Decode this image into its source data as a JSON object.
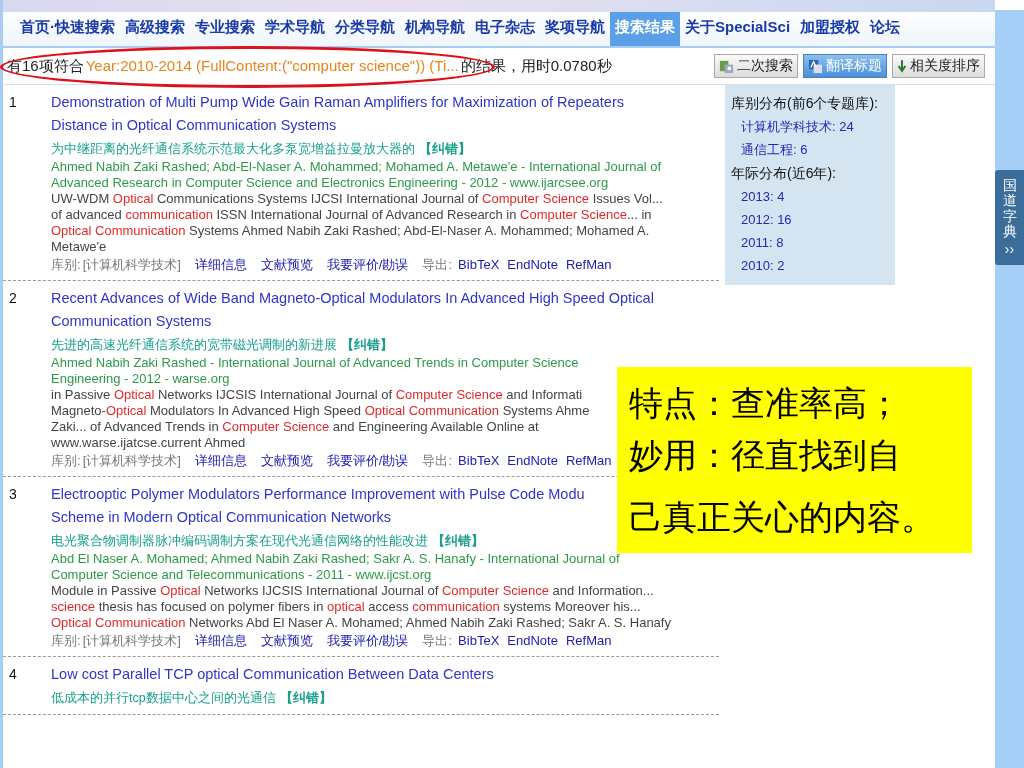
{
  "nav": [
    {
      "label": "首页·快速搜索",
      "selected": false
    },
    {
      "label": "高级搜索",
      "selected": false
    },
    {
      "label": "专业搜索",
      "selected": false
    },
    {
      "label": "学术导航",
      "selected": false
    },
    {
      "label": "分类导航",
      "selected": false
    },
    {
      "label": "机构导航",
      "selected": false
    },
    {
      "label": "电子杂志",
      "selected": false
    },
    {
      "label": "奖项导航",
      "selected": false
    },
    {
      "label": "搜索结果",
      "selected": true
    },
    {
      "label": "关于SpecialSci",
      "selected": false
    },
    {
      "label": "加盟授权",
      "selected": false
    },
    {
      "label": "论坛",
      "selected": false
    }
  ],
  "summary": {
    "prefix": "有16项符合",
    "query": "Year:2010-2014 (FullContent:(\"computer science\")) (Ti...",
    "suffix": "的结果，用时0.0780秒"
  },
  "toolbar": [
    {
      "label": "二次搜索",
      "kind": "refine",
      "selected": false
    },
    {
      "label": "翻译标题",
      "kind": "translate",
      "selected": true
    },
    {
      "label": "相关度排序",
      "kind": "sort",
      "selected": false
    }
  ],
  "results": [
    {
      "number": "1",
      "title_lines": [
        "Demonstration of Multi Pump Wide Gain Raman Amplifiers for Maximization of Repeaters",
        "Distance in Optical Communication Systems"
      ],
      "translation": "为中继距离的光纤通信系统示范最大化多泵宽增益拉曼放大器的",
      "fix": "【纠错】",
      "source_lines": [
        "Ahmed Nabih Zaki Rashed; Abd-El-Naser A. Mohammed; Mohamed A. Metawe'e - International Journal of",
        "Advanced Research in Computer Science and Electronics Engineering - 2012 - www.ijarcsee.org"
      ],
      "snippet_lines": [
        [
          {
            "text": "UW-WDM ",
            "hit": false
          },
          {
            "text": "Optical",
            "hit": true
          },
          {
            "text": " Communications Systems IJCSI International Journal of ",
            "hit": false
          },
          {
            "text": "Computer Science",
            "hit": true
          },
          {
            "text": " Issues Vol...",
            "hit": false
          }
        ],
        [
          {
            "text": "of advanced ",
            "hit": false
          },
          {
            "text": "communication",
            "hit": true
          },
          {
            "text": " ISSN International Journal of Advanced Research in ",
            "hit": false
          },
          {
            "text": "Computer Science",
            "hit": true
          },
          {
            "text": "... in",
            "hit": false
          }
        ],
        [
          {
            "text": "Optical Communication",
            "hit": true
          },
          {
            "text": " Systems Ahmed Nabih Zaki Rashed; Abd-El-Naser A. Mohammed; Mohamed A.",
            "hit": false
          }
        ],
        [
          {
            "text": "Metawe'e",
            "hit": false
          }
        ]
      ],
      "footer": {
        "library_label": "库别:",
        "library": "[计算机科学技术]",
        "links": [
          "详细信息",
          "文献预览",
          "我要评价/勘误"
        ],
        "export_label": "导出:",
        "exports": [
          "BibTeX",
          "EndNote",
          "RefMan"
        ]
      }
    },
    {
      "number": "2",
      "title_lines": [
        "Recent Advances of Wide Band Magneto-Optical Modulators In Advanced High Speed Optical",
        "Communication Systems"
      ],
      "translation": "先进的高速光纤通信系统的宽带磁光调制的新进展",
      "fix": "【纠错】",
      "source_lines": [
        "Ahmed Nabih Zaki Rashed - International Journal of Advanced Trends in Computer Science",
        "Engineering - 2012 - warse.org"
      ],
      "snippet_lines": [
        [
          {
            "text": "in Passive ",
            "hit": false
          },
          {
            "text": "Optical",
            "hit": true
          },
          {
            "text": " Networks IJCSIS International Journal of ",
            "hit": false
          },
          {
            "text": "Computer Science",
            "hit": true
          },
          {
            "text": " and Informati",
            "hit": false
          }
        ],
        [
          {
            "text": "Magneto-",
            "hit": false
          },
          {
            "text": "Optical",
            "hit": true
          },
          {
            "text": " Modulators In Advanced High Speed ",
            "hit": false
          },
          {
            "text": "Optical Communication",
            "hit": true
          },
          {
            "text": " Systems Ahme",
            "hit": false
          }
        ],
        [
          {
            "text": "Zaki... of Advanced Trends in ",
            "hit": false
          },
          {
            "text": "Computer Science",
            "hit": true
          },
          {
            "text": " and Engineering Available Online at",
            "hit": false
          }
        ],
        [
          {
            "text": "www.warse.ijatcse.current Ahmed",
            "hit": false
          }
        ]
      ],
      "footer": {
        "library_label": "库别:",
        "library": "[计算机科学技术]",
        "links": [
          "详细信息",
          "文献预览",
          "我要评价/勘误"
        ],
        "export_label": "导出:",
        "exports": [
          "BibTeX",
          "EndNote",
          "RefMan"
        ]
      }
    },
    {
      "number": "3",
      "title_lines": [
        "Electrooptic Polymer Modulators Performance Improvement with Pulse Code Modu",
        "Scheme in Modern Optical Communication Networks"
      ],
      "translation": "电光聚合物调制器脉冲编码调制方案在现代光通信网络的性能改进",
      "fix": "【纠错】",
      "source_lines": [
        "Abd El Naser A. Mohamed; Ahmed Nabih Zaki Rashed; Sakr A. S. Hanafy - International Journal of",
        "Computer Science and Telecommunications - 2011 - www.ijcst.org"
      ],
      "snippet_lines": [
        [
          {
            "text": "Module in Passive ",
            "hit": false
          },
          {
            "text": "Optical",
            "hit": true
          },
          {
            "text": " Networks IJCSIS International Journal of ",
            "hit": false
          },
          {
            "text": "Computer Science",
            "hit": true
          },
          {
            "text": " and Information...",
            "hit": false
          }
        ],
        [
          {
            "text": "science",
            "hit": true
          },
          {
            "text": " thesis has focused on polymer fibers in ",
            "hit": false
          },
          {
            "text": "optical",
            "hit": true
          },
          {
            "text": " access ",
            "hit": false
          },
          {
            "text": "communication",
            "hit": true
          },
          {
            "text": " systems Moreover his...",
            "hit": false
          }
        ],
        [
          {
            "text": "Optical Communication",
            "hit": true
          },
          {
            "text": " Networks Abd El Naser A. Mohamed; Ahmed Nabih Zaki Rashed; Sakr A. S. Hanafy",
            "hit": false
          }
        ]
      ],
      "footer": {
        "library_label": "库别:",
        "library": "[计算机科学技术]",
        "links": [
          "详细信息",
          "文献预览",
          "我要评价/勘误"
        ],
        "export_label": "导出:",
        "exports": [
          "BibTeX",
          "EndNote",
          "RefMan"
        ]
      }
    },
    {
      "number": "4",
      "title_lines": [
        "Low cost Parallel TCP optical Communication Between Data Centers"
      ],
      "translation": "低成本的并行tcp数据中心之间的光通信",
      "fix": "【纠错】"
    }
  ],
  "sidebar": {
    "sections": [
      {
        "heading": "库别分布(前6个专题库):",
        "items": [
          "计算机学科技术: 24",
          "通信工程: 6"
        ]
      },
      {
        "heading": "年际分布(近6年):",
        "items": [
          "2013: 4",
          "2012: 16",
          "2011: 8",
          "2010: 2"
        ]
      }
    ]
  },
  "side_tab": {
    "label": "国道字典",
    "arrow": "››"
  },
  "note": {
    "lines": [
      "特点：查准率高；",
      "妙用：径直找到自",
      "己真正关心的内容。"
    ]
  }
}
